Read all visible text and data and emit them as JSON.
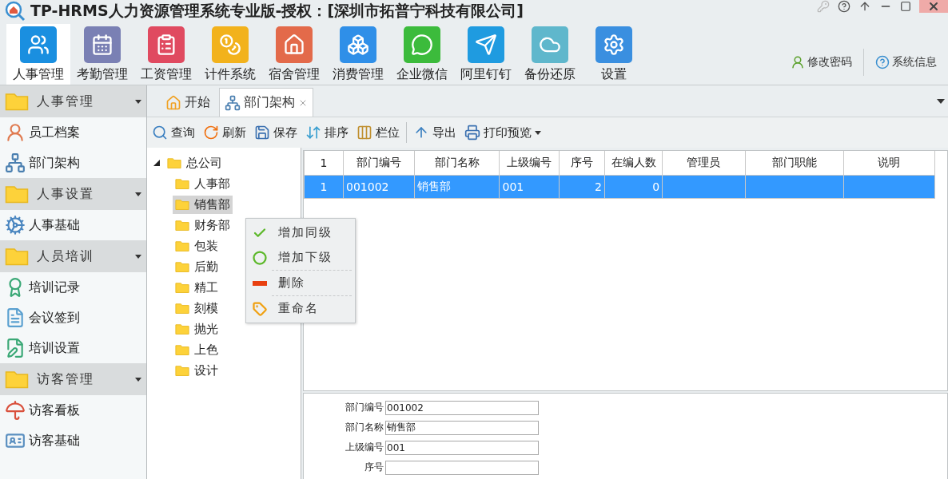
{
  "window": {
    "title": "TP-HRMS人力资源管理系统专业版-授权：[深圳市拓普宁科技有限公司]"
  },
  "modules": [
    {
      "label": "人事管理",
      "selected": true
    },
    {
      "label": "考勤管理",
      "selected": false
    },
    {
      "label": "工资管理",
      "selected": false
    },
    {
      "label": "计件系统",
      "selected": false
    },
    {
      "label": "宿舍管理",
      "selected": false
    },
    {
      "label": "消费管理",
      "selected": false
    },
    {
      "label": "企业微信",
      "selected": false
    },
    {
      "label": "阿里钉钉",
      "selected": false
    },
    {
      "label": "备份还原",
      "selected": false
    },
    {
      "label": "设置",
      "selected": false
    }
  ],
  "user_links": [
    "修改密码",
    "系统信息"
  ],
  "sidebar": {
    "sections": [
      {
        "title": "人事管理",
        "items": [
          "员工档案",
          "部门架构"
        ]
      },
      {
        "title": "人事设置",
        "items": [
          "人事基础"
        ]
      },
      {
        "title": "人员培训",
        "items": [
          "培训记录",
          "会议签到",
          "培训设置"
        ]
      },
      {
        "title": "访客管理",
        "items": [
          "访客看板",
          "访客基础"
        ]
      }
    ]
  },
  "tabs": [
    {
      "label": "开始",
      "selected": false,
      "closable": false
    },
    {
      "label": "部门架构",
      "selected": true,
      "closable": true
    }
  ],
  "toolbar": [
    [
      {
        "label": "查询",
        "kind": "search",
        "dropdown": false
      },
      {
        "label": "刷新",
        "kind": "refresh",
        "dropdown": false
      },
      {
        "label": "保存",
        "kind": "save",
        "dropdown": false
      },
      {
        "label": "排序",
        "kind": "sort",
        "dropdown": false
      },
      {
        "label": "栏位",
        "kind": "columns",
        "dropdown": false
      }
    ],
    [
      {
        "label": "导出",
        "kind": "export",
        "dropdown": false
      },
      {
        "label": "打印预览",
        "kind": "print",
        "dropdown": true
      }
    ]
  ],
  "tree": {
    "label": "总公司",
    "expanded": true,
    "selected": false,
    "children": [
      {
        "label": "人事部",
        "selected": false
      },
      {
        "label": "销售部",
        "selected": true
      },
      {
        "label": "财务部",
        "selected": false
      },
      {
        "label": "包装",
        "selected": false
      },
      {
        "label": "后勤",
        "selected": false
      },
      {
        "label": "精工",
        "selected": false
      },
      {
        "label": "刻模",
        "selected": false
      },
      {
        "label": "抛光",
        "selected": false
      },
      {
        "label": "上色",
        "selected": false
      },
      {
        "label": "设计",
        "selected": false
      }
    ]
  },
  "context_menu": [
    {
      "label": "增加同级",
      "kind": "add-sibling",
      "separator_before": false
    },
    {
      "label": "增加下级",
      "kind": "add-child",
      "separator_before": false
    },
    {
      "label": "删除",
      "kind": "delete",
      "separator_before": true
    },
    {
      "label": "重命名",
      "kind": "rename",
      "separator_before": true
    }
  ],
  "table": {
    "columns": [
      {
        "label": "1"
      },
      {
        "label": "部门编号",
        "numeric": false
      },
      {
        "label": "部门名称",
        "numeric": false
      },
      {
        "label": "上级编号",
        "numeric": false
      },
      {
        "label": "序号",
        "numeric": true
      },
      {
        "label": "在编人数",
        "numeric": true
      },
      {
        "label": "管理员"
      },
      {
        "label": "部门职能"
      },
      {
        "label": "说明"
      }
    ],
    "rows": [
      {
        "cells": [
          "1",
          "001002",
          "销售部",
          "001",
          "2",
          "0"
        ],
        "selected": true
      }
    ]
  },
  "form": [
    {
      "label": "部门编号",
      "value": "001002"
    },
    {
      "label": "部门名称",
      "value": "销售部"
    },
    {
      "label": "上级编号",
      "value": "001"
    },
    {
      "label": "序号"
    }
  ]
}
